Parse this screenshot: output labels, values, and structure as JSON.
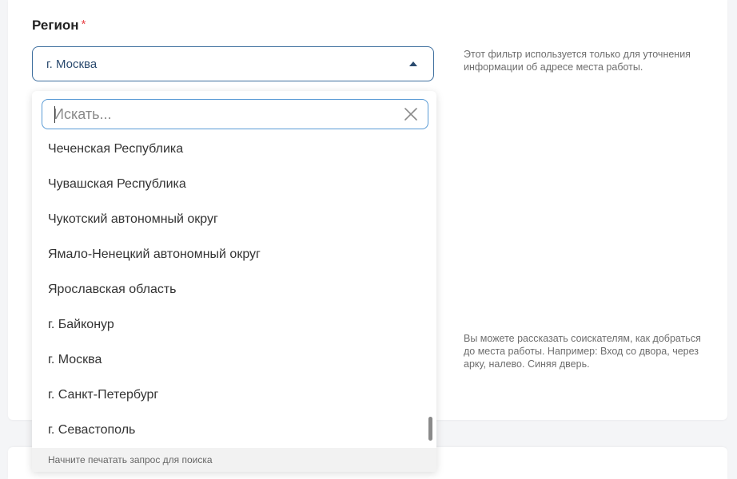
{
  "region": {
    "label": "Регион",
    "required_mark": "*",
    "selected_value": "г. Москва"
  },
  "hints": {
    "filter": "Этот фильтр используется только для уточнения информации об адресе места работы.",
    "directions": "Вы можете рассказать соискателям, как добраться до места работы. Например: Вход со двора, через арку, налево. Синяя дверь."
  },
  "dropdown": {
    "search_placeholder": "Искать...",
    "search_value": "",
    "options": [
      "Чеченская Республика",
      "Чувашская Республика",
      "Чукотский автономный округ",
      "Ямало-Ненецкий автономный округ",
      "Ярославская область",
      "г. Байконур",
      "г. Москва",
      "г. Санкт-Петербург",
      "г. Севастополь"
    ],
    "footer_hint": "Начните печатать запрос для поиска"
  },
  "colors": {
    "accent_border": "#3d6e9e",
    "search_border": "#5a9bd5",
    "required": "#e8464a"
  },
  "icons": {
    "caret": "caret-up-icon",
    "clear": "close-icon"
  }
}
